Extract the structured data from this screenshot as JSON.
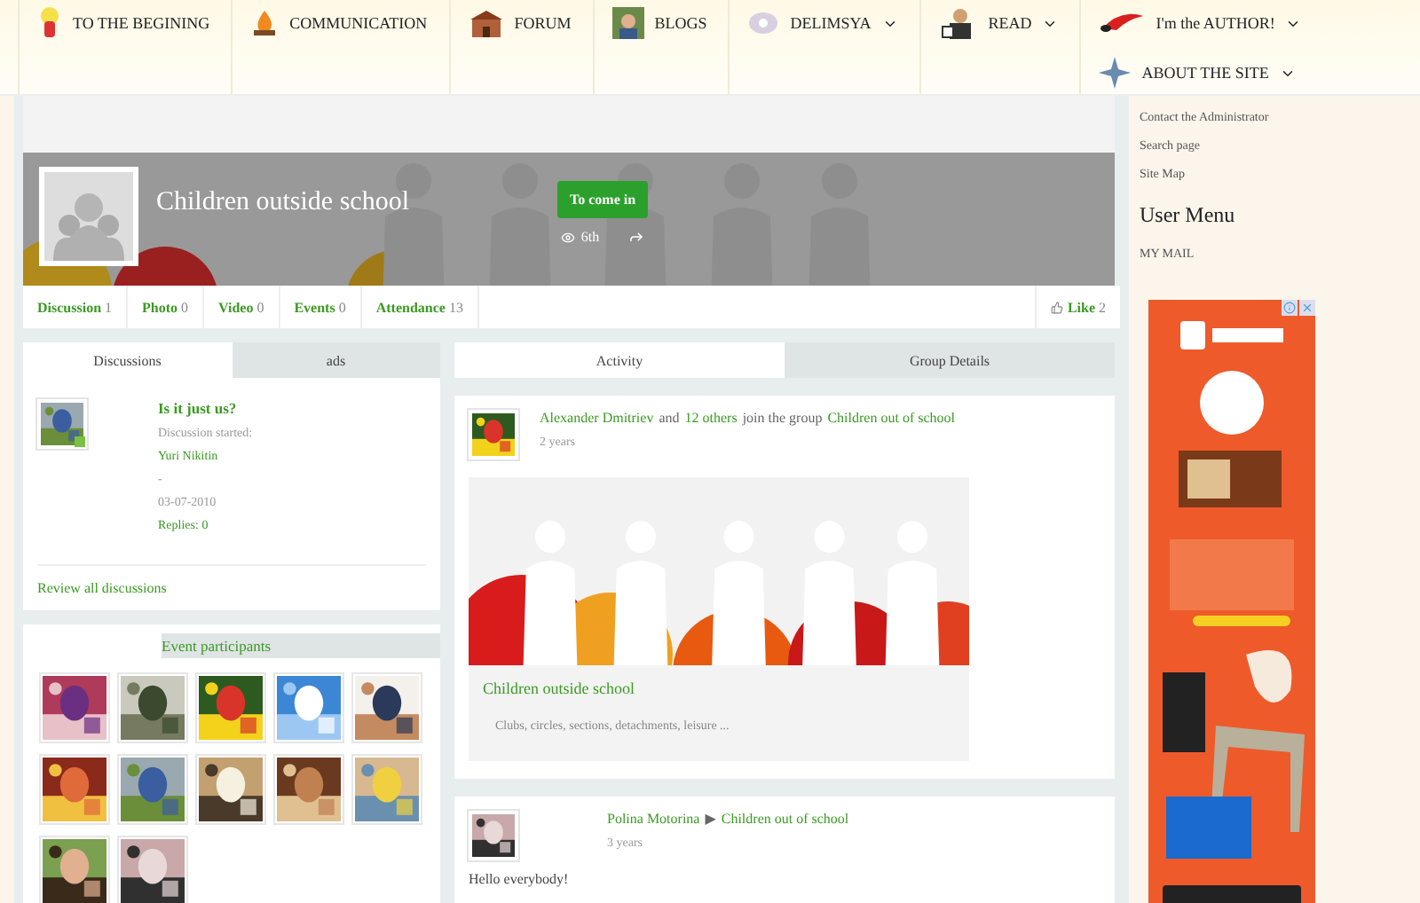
{
  "nav": {
    "items": [
      {
        "label": "TO THE BEGINING",
        "dropdown": false
      },
      {
        "label": "COMMUNICATION",
        "dropdown": false
      },
      {
        "label": "FORUM",
        "dropdown": false
      },
      {
        "label": "BLOGS",
        "dropdown": false
      },
      {
        "label": "DELIMSYA",
        "dropdown": true
      },
      {
        "label": "READ",
        "dropdown": true
      },
      {
        "label": "I'm the AUTHOR!",
        "dropdown": true
      },
      {
        "label": "ABOUT THE SITE",
        "dropdown": true
      }
    ]
  },
  "group": {
    "title": "Children outside school",
    "join_button": "To come in",
    "views": "6th"
  },
  "stats": [
    {
      "label": "Discussion",
      "count": "1"
    },
    {
      "label": "Photo",
      "count": "0"
    },
    {
      "label": "Video",
      "count": "0"
    },
    {
      "label": "Events",
      "count": "0"
    },
    {
      "label": "Attendance",
      "count": "13"
    }
  ],
  "like": {
    "label": "Like",
    "count": "2"
  },
  "left_tabs": [
    {
      "label": "Discussions",
      "selected": true
    },
    {
      "label": "ads",
      "selected": false
    }
  ],
  "discussion": {
    "online": true,
    "title": "Is it just us?",
    "started": "Discussion started:",
    "author": "Yuri Nikitin",
    "separator": "-",
    "date": "03-07-2010",
    "replies": "Replies: 0",
    "review_link": "Review all discussions"
  },
  "participants": {
    "title": "Event participants"
  },
  "right_tabs": [
    {
      "label": "Activity",
      "selected": true
    },
    {
      "label": "Group Details",
      "selected": false
    }
  ],
  "activities": [
    {
      "parts": [
        {
          "text": "Alexander Dmitriev",
          "link": true
        },
        {
          "text": "and",
          "link": false
        },
        {
          "text": "12 others",
          "link": true
        },
        {
          "text": "join the group",
          "link": false
        },
        {
          "text": "Children out of school",
          "link": true
        }
      ],
      "time": "2 years",
      "attachment": {
        "title": "Children outside school",
        "description": "Clubs, circles, sections, detachments, leisure ..."
      }
    },
    {
      "parts": [
        {
          "text": "Polina Motorina",
          "link": true
        },
        {
          "text": "▶",
          "link": false
        },
        {
          "text": "Children out of school",
          "link": true
        }
      ],
      "time": "3 years",
      "body": "Hello everybody!"
    }
  ],
  "sidebar": {
    "links": [
      "Contact the Administrator",
      "Search page",
      "Site Map"
    ],
    "user_menu_title": "User Menu",
    "user_menu": [
      "MY MAIL"
    ]
  }
}
